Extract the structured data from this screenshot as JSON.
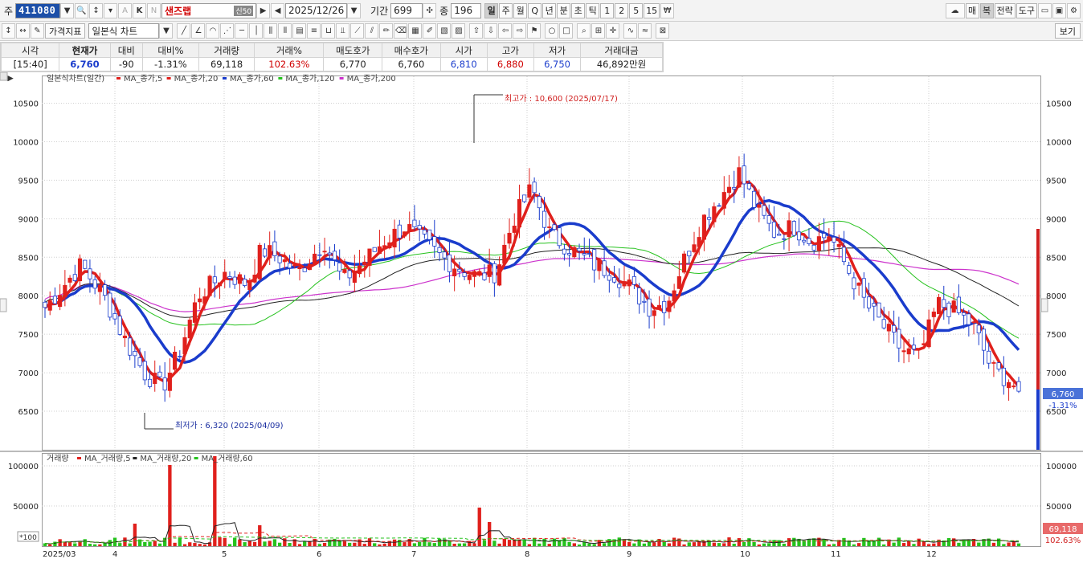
{
  "toolbar": {
    "market_label": "주",
    "code": "411080",
    "name": "샌즈랩",
    "name_badge": "신50",
    "date": "2025/12/26",
    "period_label": "기간",
    "period_value": "699",
    "count_label": "종",
    "count_value": "196",
    "periods": [
      "일",
      "주",
      "월",
      "Q",
      "년",
      "분",
      "초",
      "틱",
      "1",
      "2",
      "5",
      "15"
    ],
    "right_buttons": [
      "매",
      "복",
      "전략",
      "도구"
    ],
    "price_indicator": "가격지표",
    "chart_type": "일본식 차트",
    "view_button": "보기"
  },
  "info": {
    "headers": [
      "시각",
      "현재가",
      "대비",
      "대비%",
      "거래량",
      "거래%",
      "매도호가",
      "매수호가",
      "시가",
      "고가",
      "저가",
      "거래대금"
    ],
    "values": [
      "[15:40]",
      "6,760",
      "-90",
      "-1.31%",
      "69,118",
      "102.63%",
      "6,770",
      "6,760",
      "6,810",
      "6,880",
      "6,750",
      "46,892만원"
    ]
  },
  "chart_title": "일본식차트(일간)",
  "ma_legend": [
    "MA_종가,5",
    "MA_종가,20",
    "MA_종가,60",
    "MA_종가,120",
    "MA_종가,200"
  ],
  "ma_colors": {
    "ma5": "#e0201c",
    "ma20": "#e0201c",
    "ma60": "#1a3ccc",
    "ma120": "#26c21e",
    "ma200": "#cc33cc"
  },
  "annotations": {
    "high": "최고가 : 10,600 (2025/07/17)",
    "low": "최저가 : 6,320 (2025/04/09)"
  },
  "price_axis": [
    "10500",
    "10000",
    "9500",
    "9000",
    "8500",
    "8000",
    "7500",
    "7000",
    "6500"
  ],
  "current_price_tag": "6,760",
  "current_change_tag": "-1.31%",
  "volume_title": "거래량",
  "volume_legend": [
    "MA_거래량,5",
    "MA_거래량,20",
    "MA_거래량,60"
  ],
  "volume_axis": [
    "100000",
    "50000"
  ],
  "volume_scale": "*100",
  "volume_tag": "69,118",
  "volume_pct_tag": "102.63%",
  "x_labels": [
    "2025/03",
    "4",
    "5",
    "6",
    "7",
    "8",
    "9",
    "10",
    "11",
    "12"
  ],
  "chart_data": {
    "type": "candlestick",
    "ylim": [
      6000,
      10850
    ],
    "volume_ylim": [
      0,
      115000
    ],
    "monthly_closes": [
      {
        "month": "2025/03",
        "close": 7850
      },
      {
        "month": "4",
        "close": 8300
      },
      {
        "month": "5",
        "close": 8500
      },
      {
        "month": "6",
        "close": 8700
      },
      {
        "month": "7",
        "close": 9200
      },
      {
        "month": "8",
        "close": 8400
      },
      {
        "month": "9",
        "close": 9200
      },
      {
        "month": "10",
        "close": 8600
      },
      {
        "month": "11",
        "close": 7300
      },
      {
        "month": "12",
        "close": 6760
      }
    ],
    "extremes": {
      "high": 10600,
      "low": 6320,
      "last": 6760
    }
  }
}
